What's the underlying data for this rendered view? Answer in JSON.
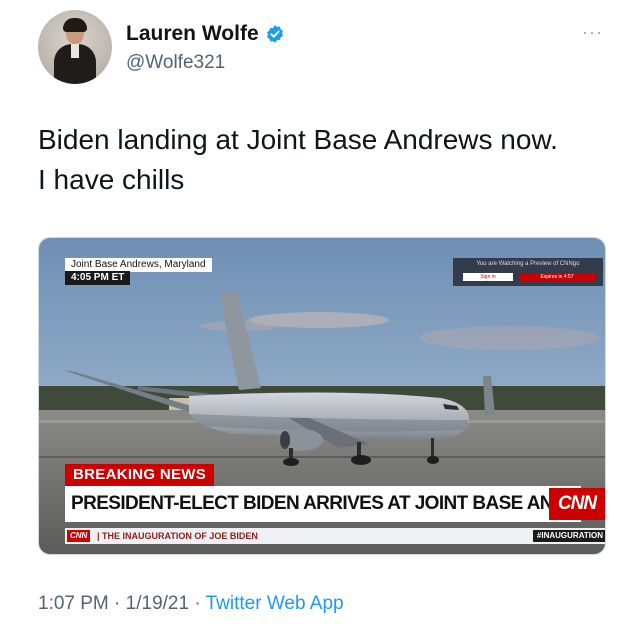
{
  "author": {
    "display_name": "Lauren Wolfe",
    "handle": "@Wolfe321",
    "verified_icon": "verified-badge-icon",
    "more_icon": "···"
  },
  "tweet": {
    "text_line1": "Biden landing at Joint Base Andrews now.",
    "text_line2": "I have chills"
  },
  "media": {
    "location": "Joint Base Andrews, Maryland",
    "time": "4:05 PM ET",
    "preview_text": "You are Watching a Preview of CNNgo",
    "preview_signin": "Sign in",
    "preview_expires": "Expires in 4:57",
    "breaking_label": "BREAKING NEWS",
    "headline": "PRESIDENT-ELECT BIDEN ARRIVES AT JOINT BASE ANDREWS",
    "logo": "CNN",
    "ticker_logo": "CNN",
    "ticker_text": "| THE INAUGURATION OF JOE BIDEN",
    "ticker_tag": "#INAUGURATION"
  },
  "footer": {
    "time": "1:07 PM",
    "separator1": " · ",
    "date": "1/19/21",
    "separator2": " · ",
    "source": "Twitter Web App"
  },
  "colors": {
    "link_blue": "#1d9bf0",
    "cnn_red": "#cc0000",
    "muted_gray": "#536471"
  }
}
